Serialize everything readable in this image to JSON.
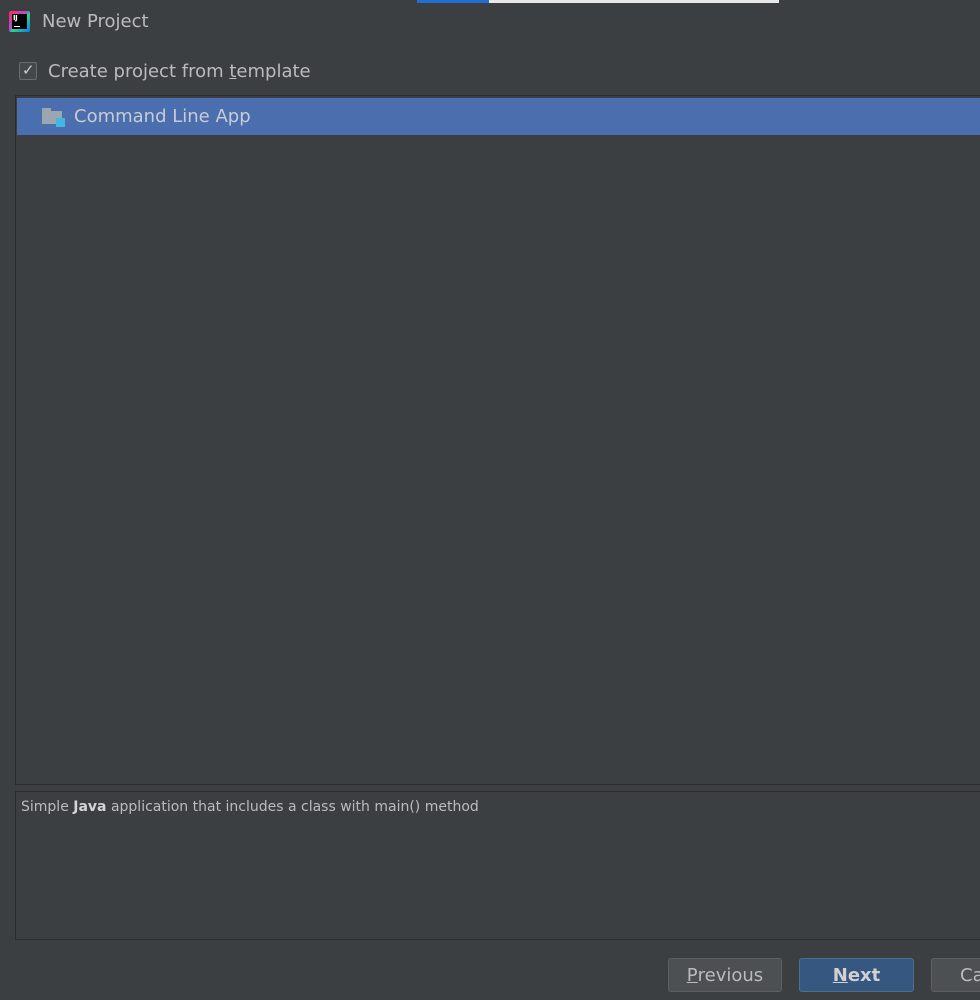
{
  "window": {
    "title": "New Project",
    "app_icon": "intellij-idea-icon",
    "progress_fraction": 0.2
  },
  "template_option": {
    "checked": true,
    "label_before": "Create project from ",
    "label_mnemonic": "t",
    "label_after": "emplate"
  },
  "templates": {
    "items": [
      {
        "label": "Command Line App",
        "icon": "folder-icon",
        "selected": true
      }
    ]
  },
  "description": {
    "prefix": "Simple ",
    "bold": "Java",
    "suffix": " application that includes a class with main() method"
  },
  "buttons": {
    "previous": {
      "mnemonic": "P",
      "rest": "revious"
    },
    "next": {
      "mnemonic": "N",
      "rest": "ext"
    },
    "cancel": {
      "visible_text": "Ca"
    }
  },
  "colors": {
    "background": "#3c3f41",
    "selection": "#4b6eaf",
    "default_button": "#365880",
    "progress": "#1f6fd0"
  }
}
